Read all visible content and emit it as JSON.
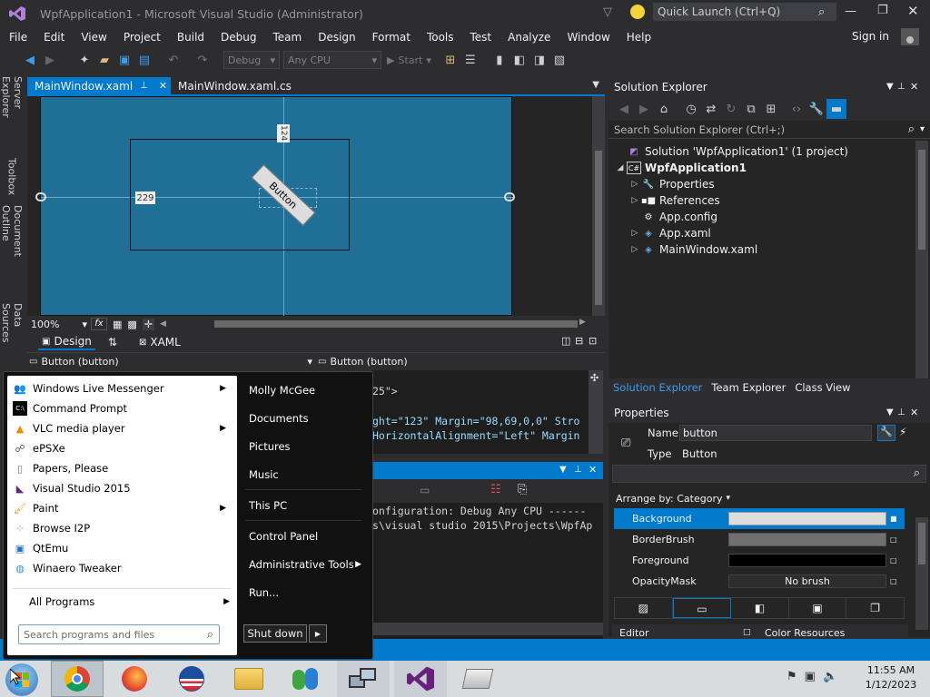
{
  "window": {
    "title": "WpfApplication1 - Microsoft Visual Studio (Administrator)",
    "quick_launch_placeholder": "Quick Launch (Ctrl+Q)",
    "sign_in": "Sign in"
  },
  "menu": [
    "File",
    "Edit",
    "View",
    "Project",
    "Build",
    "Debug",
    "Team",
    "Design",
    "Format",
    "Tools",
    "Test",
    "Analyze",
    "Window",
    "Help"
  ],
  "toolbar": {
    "config": "Debug",
    "platform": "Any CPU",
    "start_label": "Start"
  },
  "left_sidebar": [
    "Server Explorer",
    "Toolbox",
    "Document Outline",
    "Data Sources"
  ],
  "editor": {
    "tabs": [
      "MainWindow.xaml",
      "MainWindow.xaml.cs"
    ],
    "zoom": "100%",
    "fx": "fx",
    "design_label": "Design",
    "xaml_label": "XAML",
    "margin_top": "124",
    "margin_left": "229",
    "button_text": "Button",
    "nav_left": "Button (button)",
    "nav_right": "Button (button)",
    "code_line_1": "25\">",
    "code_line_2": "ght=\"123\" Margin=\"98,69,0,0\" Stro",
    "code_line_3": "HorizontalAlignment=\"Left\" Margin",
    "output_line_1": "onfiguration: Debug Any CPU ------",
    "output_line_2": "s\\visual studio 2015\\Projects\\WpfAp"
  },
  "solution_explorer": {
    "title": "Solution Explorer",
    "search_placeholder": "Search Solution Explorer (Ctrl+;)",
    "solution": "Solution 'WpfApplication1' (1 project)",
    "project": "WpfApplication1",
    "items": [
      "Properties",
      "References",
      "App.config",
      "App.xaml",
      "MainWindow.xaml"
    ],
    "bottom_tabs": [
      "Solution Explorer",
      "Team Explorer",
      "Class View"
    ]
  },
  "properties": {
    "title": "Properties",
    "name_label": "Name",
    "name_value": "button",
    "type_label": "Type",
    "type_value": "Button",
    "arrange_by": "Arrange by: Category",
    "rows": [
      {
        "label": "Background",
        "value": ""
      },
      {
        "label": "BorderBrush",
        "value": ""
      },
      {
        "label": "Foreground",
        "value": ""
      },
      {
        "label": "OpacityMask",
        "value": "No brush"
      }
    ],
    "bottom_left": "Editor",
    "bottom_right": "Color Resources",
    "colors": {
      "background": "#dddddd",
      "borderbrush": "#707070",
      "foreground": "#000000"
    }
  },
  "start_menu": {
    "programs": [
      {
        "label": "Windows Live Messenger",
        "icon": "messenger-icon",
        "arrow": true
      },
      {
        "label": "Command Prompt",
        "icon": "cmd-icon",
        "arrow": false
      },
      {
        "label": "VLC media player",
        "icon": "vlc-icon",
        "arrow": true
      },
      {
        "label": "ePSXe",
        "icon": "epsxe-icon",
        "arrow": false
      },
      {
        "label": "Papers, Please",
        "icon": "papers-icon",
        "arrow": false
      },
      {
        "label": "Visual Studio 2015",
        "icon": "vs-icon",
        "arrow": false
      },
      {
        "label": "Paint",
        "icon": "paint-icon",
        "arrow": true
      },
      {
        "label": "Browse I2P",
        "icon": "i2p-icon",
        "arrow": false
      },
      {
        "label": "QtEmu",
        "icon": "qtemu-icon",
        "arrow": false
      },
      {
        "label": "Winaero Tweaker",
        "icon": "winaero-icon",
        "arrow": false
      }
    ],
    "all_programs": "All Programs",
    "search_placeholder": "Search programs and files",
    "right_items": [
      "Molly McGee",
      "Documents",
      "Pictures",
      "Music",
      "This PC",
      "Control Panel",
      "Administrative Tools",
      "Run..."
    ],
    "shutdown": "Shut down"
  },
  "taskbar": {
    "time": "11:55 AM",
    "date": "1/12/2023"
  }
}
